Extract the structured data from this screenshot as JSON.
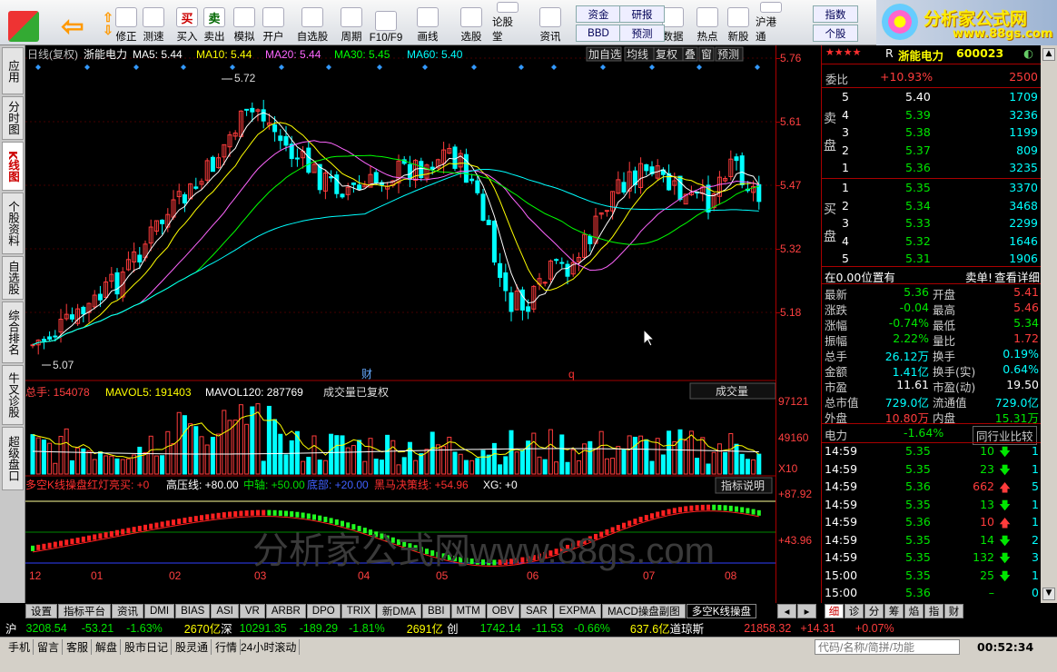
{
  "toolbar": {
    "buttons": [
      {
        "label": "修正",
        "icon": "refresh-up-icon"
      },
      {
        "label": "测速",
        "icon": "clock-icon"
      },
      {
        "label": "买入",
        "icon": "buy-icon",
        "glyph": "买"
      },
      {
        "label": "卖出",
        "icon": "sell-icon",
        "glyph": "卖"
      },
      {
        "label": "模拟",
        "icon": "hammer-icon"
      },
      {
        "label": "开户",
        "icon": "lock-icon"
      },
      {
        "label": "自选股",
        "icon": "star-folder-icon"
      },
      {
        "label": "周期",
        "icon": "period-clock-icon"
      },
      {
        "label": "F10/F9",
        "icon": "f10-icon"
      },
      {
        "label": "画线",
        "icon": "pen-icon"
      },
      {
        "label": "选股",
        "icon": "select-stock-icon"
      },
      {
        "label": "论股堂",
        "icon": "forum-icon"
      },
      {
        "label": "资讯",
        "icon": "news-icon"
      },
      {
        "label": "数据",
        "icon": "pe-data-icon"
      },
      {
        "label": "热点",
        "icon": "hot-icon"
      },
      {
        "label": "新股",
        "icon": "new-stock-icon"
      },
      {
        "label": "沪港通",
        "icon": "shhk-icon"
      }
    ],
    "small": {
      "fund": "资金",
      "bbd": "BBD",
      "research": "研报",
      "forecast": "预测",
      "index": "指数",
      "individual": "个股"
    },
    "logo_title": "分析家公式网",
    "logo_url": "www.88gs.com"
  },
  "left_tabs": [
    "应用",
    "分时图",
    "K线图",
    "个股资料",
    "自选股",
    "综合排名",
    "牛叉诊股",
    "超级盘口"
  ],
  "chart": {
    "header": {
      "period": "日线(复权)",
      "name": "浙能电力",
      "ma5": "MA5: 5.44",
      "ma10": "MA10: 5.44",
      "ma20": "MA20: 5.44",
      "ma30": "MA30: 5.45",
      "ma60": "MA60: 5.40"
    },
    "header_buttons": [
      "加自选",
      "均线",
      "复权",
      "叠",
      "窗",
      "预测"
    ],
    "price_ticks": [
      "5.76",
      "5.61",
      "5.47",
      "5.32",
      "5.18"
    ],
    "high_label": "5.72",
    "low_label": "5.07",
    "marks": [
      "财",
      "q"
    ],
    "vol_header": {
      "total": "总手: 154078",
      "mavol5": "MAVOL5: 191403",
      "mavol120": "MAVOL120: 287769",
      "note": "成交量已复权",
      "dropdown": "成交量"
    },
    "vol_ticks": [
      "97121",
      "49160",
      "X10"
    ],
    "ind_header": {
      "name": "多空K线操盘",
      "a": "红灯亮买: +0",
      "b": "高压线: +80.00",
      "c": "中轴: +50.00",
      "d": "底部: +20.00",
      "e": "黑马决策线: +54.96",
      "f": "XG: +0",
      "help": "指标说明"
    },
    "ind_ticks": [
      "+87.92",
      "+43.96"
    ],
    "months": [
      "12",
      "01",
      "02",
      "03",
      "04",
      "05",
      "06",
      "07",
      "08"
    ],
    "watermark": "分析家公式网www.88gs.com",
    "chart_data": {
      "type": "candlestick",
      "title": "浙能电力 日线(复权)",
      "ylim": [
        5.07,
        5.76
      ],
      "months": [
        "12",
        "01",
        "02",
        "03",
        "04",
        "05",
        "06",
        "07",
        "08"
      ],
      "high": 5.72,
      "low": 5.07,
      "last_ma": {
        "MA5": 5.44,
        "MA10": 5.44,
        "MA20": 5.44,
        "MA30": 5.45,
        "MA60": 5.4
      },
      "volume": {
        "total": 154078,
        "MAVOL5": 191403,
        "MAVOL120": 287769
      }
    }
  },
  "quote": {
    "title": "浙能电力",
    "code": "600023",
    "prefix": "R",
    "weibi_label": "委比",
    "weibi": "+10.93%",
    "weicha": "2500",
    "sell_label": [
      "卖",
      "盘"
    ],
    "buy_label": [
      "买",
      "盘"
    ],
    "sell": [
      {
        "n": "5",
        "p": "5.40",
        "v": "1709"
      },
      {
        "n": "4",
        "p": "5.39",
        "v": "3236"
      },
      {
        "n": "3",
        "p": "5.38",
        "v": "1199"
      },
      {
        "n": "2",
        "p": "5.37",
        "v": "809"
      },
      {
        "n": "1",
        "p": "5.36",
        "v": "3235"
      }
    ],
    "buy": [
      {
        "n": "1",
        "p": "5.35",
        "v": "3370"
      },
      {
        "n": "2",
        "p": "5.34",
        "v": "3468"
      },
      {
        "n": "3",
        "p": "5.33",
        "v": "2299"
      },
      {
        "n": "4",
        "p": "5.32",
        "v": "1646"
      },
      {
        "n": "5",
        "p": "5.31",
        "v": "1906"
      }
    ],
    "position": "在0.00位置有",
    "sell_one": "卖单!",
    "detail": "查看详细",
    "stats": [
      {
        "k1": "最新",
        "v1": "5.36",
        "c1": "green",
        "k2": "开盘",
        "v2": "5.41",
        "c2": "red"
      },
      {
        "k1": "涨跌",
        "v1": "-0.04",
        "c1": "green",
        "k2": "最高",
        "v2": "5.46",
        "c2": "red"
      },
      {
        "k1": "涨幅",
        "v1": "-0.74%",
        "c1": "green",
        "k2": "最低",
        "v2": "5.34",
        "c2": "green"
      },
      {
        "k1": "振幅",
        "v1": "2.22%",
        "c1": "green",
        "k2": "量比",
        "v2": "1.72",
        "c2": "red"
      },
      {
        "k1": "总手",
        "v1": "26.12万",
        "c1": "cyan",
        "k2": "换手",
        "v2": "0.19%",
        "c2": "cyan"
      },
      {
        "k1": "金额",
        "v1": "1.41亿",
        "c1": "cyan",
        "k2": "换手(实)",
        "v2": "0.64%",
        "c2": "cyan"
      },
      {
        "k1": "市盈",
        "v1": "11.61",
        "c1": "white",
        "k2": "市盈(动)",
        "v2": "19.50",
        "c2": "white"
      },
      {
        "k1": "总市值",
        "v1": "729.0亿",
        "c1": "cyan",
        "k2": "流通值",
        "v2": "729.0亿",
        "c2": "cyan"
      },
      {
        "k1": "外盘",
        "v1": "10.80万",
        "c1": "red",
        "k2": "内盘",
        "v2": "15.31万",
        "c2": "green"
      }
    ],
    "sector": "电力",
    "sector_change": "-1.64%",
    "compare": "同行业比较",
    "ticks": [
      {
        "t": "14:59",
        "p": "5.35",
        "v": "10",
        "d": "down",
        "n": "1"
      },
      {
        "t": "14:59",
        "p": "5.35",
        "v": "23",
        "d": "down",
        "n": "1"
      },
      {
        "t": "14:59",
        "p": "5.36",
        "v": "662",
        "d": "up",
        "n": "5"
      },
      {
        "t": "14:59",
        "p": "5.35",
        "v": "13",
        "d": "down",
        "n": "1"
      },
      {
        "t": "14:59",
        "p": "5.36",
        "v": "10",
        "d": "up",
        "n": "1"
      },
      {
        "t": "14:59",
        "p": "5.35",
        "v": "14",
        "d": "down",
        "n": "2"
      },
      {
        "t": "14:59",
        "p": "5.35",
        "v": "132",
        "d": "down",
        "n": "3"
      },
      {
        "t": "15:00",
        "p": "5.35",
        "v": "25",
        "d": "down",
        "n": "1"
      },
      {
        "t": "15:00",
        "p": "5.36",
        "v": "–",
        "d": "",
        "n": "0"
      }
    ]
  },
  "bottom_tabs": [
    "设置",
    "指标平台",
    "资讯",
    "DMI",
    "BIAS",
    "ASI",
    "VR",
    "ARBR",
    "DPO",
    "TRIX",
    "新DMA",
    "BBI",
    "MTM",
    "OBV",
    "SAR",
    "EXPMA",
    "MACD操盘副图",
    "多空K线操盘"
  ],
  "right_tabs": [
    "细",
    "诊",
    "分",
    "筹",
    "焰",
    "指",
    "财"
  ],
  "ticker": {
    "sh": "沪",
    "sh_idx": "3208.54",
    "sh_chg": "-53.21",
    "sh_pct": "-1.63%",
    "sh_amt": "2670亿",
    "sz": "深",
    "sz_idx": "10291.35",
    "sz_chg": "-189.29",
    "sz_pct": "-1.81%",
    "sz_amt": "2691亿",
    "cy": "创",
    "cy_idx": "1742.14",
    "cy_chg": "-11.53",
    "cy_pct": "-0.66%",
    "cy_amt": "637.6亿",
    "dj": "道琼斯",
    "dj_idx": "21858.32",
    "dj_chg": "+14.31",
    "dj_pct": "+0.07%"
  },
  "status": {
    "items": [
      "手机",
      "留言",
      "客服",
      "解盘",
      "股市日记",
      "股灵通",
      "行情",
      "24小时滚动"
    ],
    "search_placeholder": "代码/名称/简拼/功能",
    "time": "00:52:34"
  },
  "colors": {
    "up": "#ff3c3c",
    "down": "#00ffff",
    "axis": "#a00000"
  }
}
